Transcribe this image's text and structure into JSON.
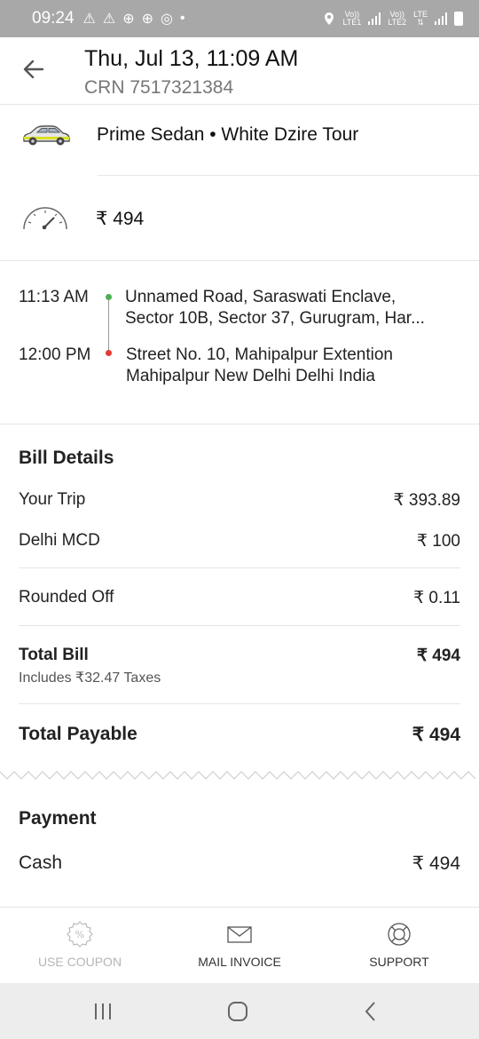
{
  "status_bar": {
    "time": "09:24",
    "sim1_label_top": "Vo))",
    "sim1_label_bottom": "LTE1",
    "sim2_label_top": "Vo))",
    "sim2_label_bottom": "LTE2",
    "lte_label": "LTE"
  },
  "header": {
    "title": "Thu, Jul 13, 11:09 AM",
    "subtitle": "CRN 7517321384"
  },
  "ride": {
    "car_label": "Prime Sedan • White Dzire Tour",
    "fare": "₹ 494"
  },
  "route": {
    "pickup_time": "11:13 AM",
    "pickup_address_line1": "Unnamed Road, Saraswati Enclave,",
    "pickup_address_line2": "Sector 10B, Sector 37, Gurugram, Har...",
    "drop_time": "12:00 PM",
    "drop_address_line1": "Street No. 10, Mahipalpur Extention",
    "drop_address_line2": "Mahipalpur New Delhi Delhi India",
    "pickup_color": "#4caf50",
    "drop_color": "#e53935"
  },
  "bill": {
    "title": "Bill Details",
    "items": [
      {
        "label": "Your Trip",
        "amount": "₹ 393.89"
      },
      {
        "label": "Delhi MCD",
        "amount": "₹ 100"
      },
      {
        "label": "Rounded Off",
        "amount": "₹ 0.11"
      }
    ],
    "total_label": "Total Bill",
    "total_amount": "₹ 494",
    "taxes_note": "Includes ₹32.47 Taxes",
    "payable_label": "Total Payable",
    "payable_amount": "₹ 494"
  },
  "payment": {
    "title": "Payment",
    "method": "Cash",
    "amount": "₹ 494"
  },
  "footer": {
    "coupon_label": "USE COUPON",
    "invoice_label": "MAIL INVOICE",
    "support_label": "SUPPORT"
  }
}
